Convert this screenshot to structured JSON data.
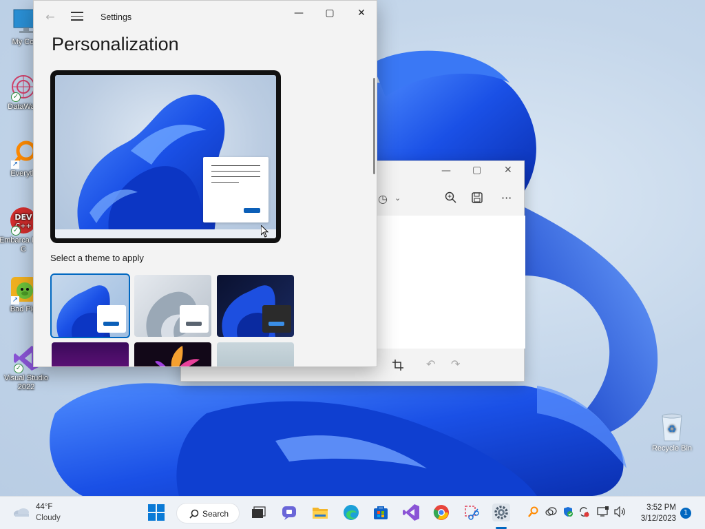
{
  "desktop": {
    "icons": [
      {
        "label": "My Com",
        "icon": "monitor-icon"
      },
      {
        "label": "DataWag",
        "icon": "datawag-icon"
      },
      {
        "label": "Everyth",
        "icon": "everything-search-icon"
      },
      {
        "label": "Embarca Dev-C",
        "icon": "devcpp-icon"
      },
      {
        "label": "Bad Pig",
        "icon": "bad-piggies-icon"
      },
      {
        "label": "Visual Studio 2022",
        "icon": "visual-studio-icon"
      }
    ],
    "recycle_bin": "Recycle Bin"
  },
  "settings": {
    "window_title": "Settings",
    "page_title": "Personalization",
    "section_label": "Select a theme to apply",
    "controls": {
      "minimize": "—",
      "maximize": "▢",
      "close": "✕"
    }
  },
  "snipping_tool": {
    "controls": {
      "minimize": "—",
      "maximize": "▢",
      "close": "✕"
    }
  },
  "taskbar": {
    "weather": {
      "temp": "44°F",
      "condition": "Cloudy"
    },
    "search_label": "Search",
    "clock": {
      "time": "3:52 PM",
      "date": "3/12/2023"
    },
    "notification_count": "1"
  },
  "colors": {
    "accent": "#0067c0",
    "bloom": "#1a56e0"
  }
}
